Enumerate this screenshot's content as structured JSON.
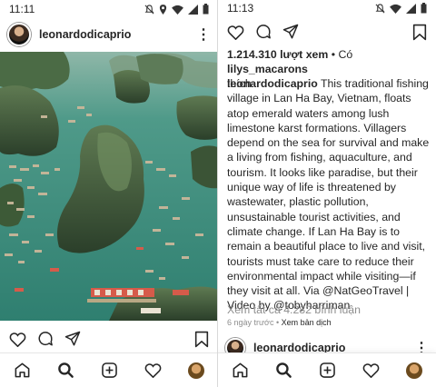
{
  "left": {
    "status_time": "11:11",
    "username": "leonardodicaprio",
    "kebab": "⋮"
  },
  "right": {
    "status_time": "11:13",
    "likes": {
      "count": "1.214.310 lượt xem",
      "liked_by_prefix": " • Có ",
      "liked_by_user": "lilys_macarons",
      "liked_by_suffix": "thích"
    },
    "caption": {
      "user": "leonardodicaprio",
      "text": " This traditional fishing village in Lan Ha Bay, Vietnam, floats atop emerald waters among lush limestone karst formations. Villagers depend on the sea for survival and make a living from fishing, aquaculture, and tourism. It looks like paradise, but their unique way of life is threatened by wastewater, plastic pollution, unsustainable tourist activities, and climate change. If Lan Ha Bay is to remain a beautiful place to live and visit, tourists must take care to reduce their environmental impact while visiting—if they visit at all. Via @NatGeoTravel | Video by @tobyharriman"
    },
    "view_comments": "Xem tất cả 4.282 bình luận",
    "meta_time": "6 ngày trước",
    "meta_sep": " • ",
    "meta_translate": "Xem bản dịch",
    "next_username": "leonardodicaprio",
    "kebab": "⋮"
  },
  "icons": {
    "like": "heart-icon",
    "comment": "comment-icon",
    "share": "direct-share-icon",
    "save": "bookmark-icon",
    "home": "home-icon",
    "search": "search-icon",
    "new_post": "new-post-icon",
    "activity": "activity-heart-icon",
    "profile": "profile-avatar"
  },
  "colors": {
    "text": "#262626",
    "muted": "#8e8e8e",
    "water": "#3f8f80"
  }
}
